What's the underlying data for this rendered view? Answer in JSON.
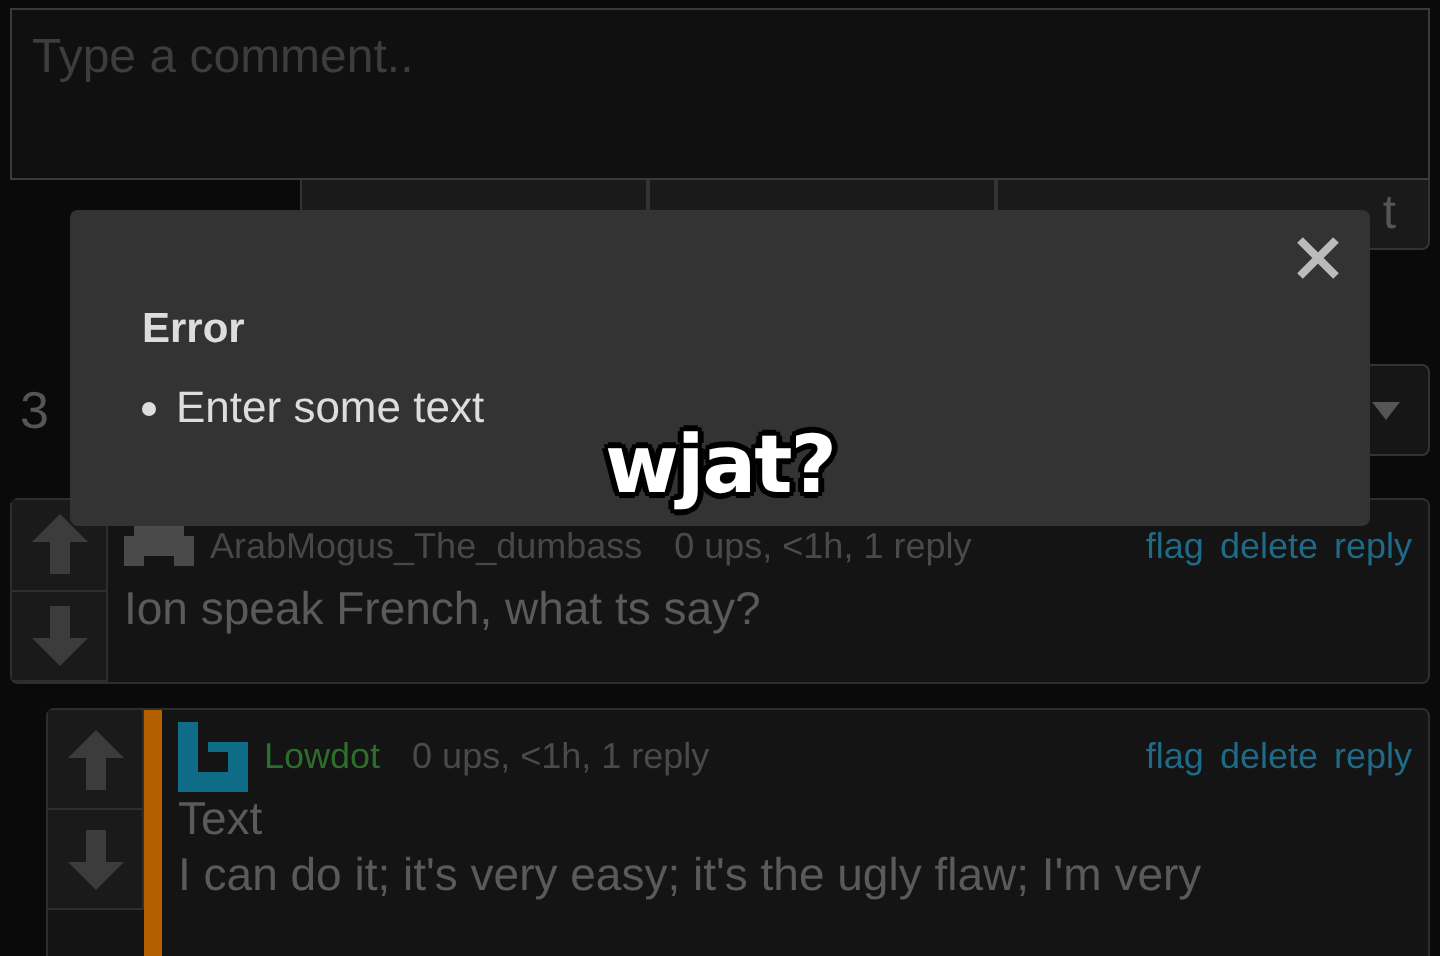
{
  "comment_box": {
    "placeholder": "Type a comment.."
  },
  "post_button": {
    "label": "t"
  },
  "comment_count": "3",
  "comments": [
    {
      "kind": "top",
      "author": "ArabMogus_The_dumbass",
      "meta": "0 ups, <1h, 1 reply",
      "actions": [
        "flag",
        "delete",
        "reply"
      ],
      "lines": [
        "Ion speak French, what ts say?"
      ]
    },
    {
      "kind": "reply",
      "author": "Lowdot",
      "meta": "0 ups, <1h, 1 reply",
      "actions": [
        "flag",
        "delete",
        "reply"
      ],
      "lines": [
        "Text",
        "I can do it; it's very easy; it's the ugly flaw; I'm very"
      ]
    }
  ],
  "modal": {
    "title": "Error",
    "errors": [
      "Enter some text"
    ]
  },
  "caption": "wjat?"
}
